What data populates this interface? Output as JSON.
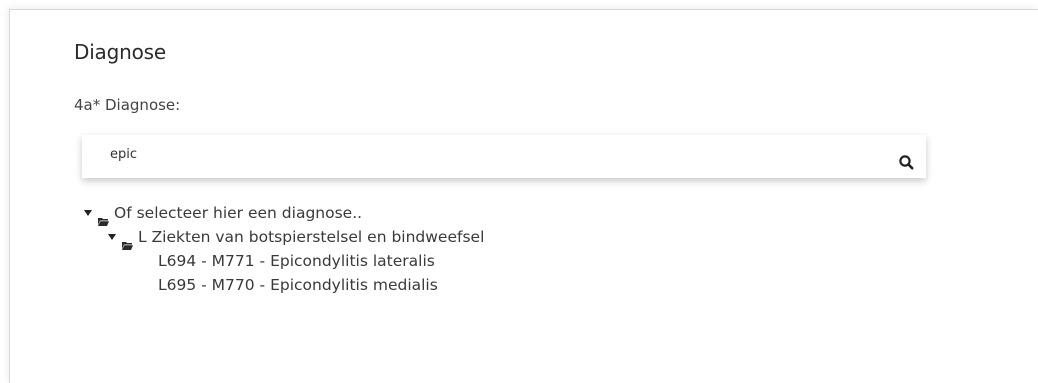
{
  "section": {
    "title": "Diagnose"
  },
  "diagnosis_field": {
    "label": "4a* Diagnose:",
    "value": "epic"
  },
  "tree": {
    "root_label": "Of selecteer hier een diagnose..",
    "group_label": "L Ziekten van botspierstelsel en bindweefsel",
    "items": [
      "L694 - M771 - Epicondylitis lateralis",
      "L695 - M770 - Epicondylitis medialis"
    ]
  },
  "icons": {
    "search": "search-icon",
    "folder": "folder-open-icon",
    "caret": "caret-down-icon"
  }
}
